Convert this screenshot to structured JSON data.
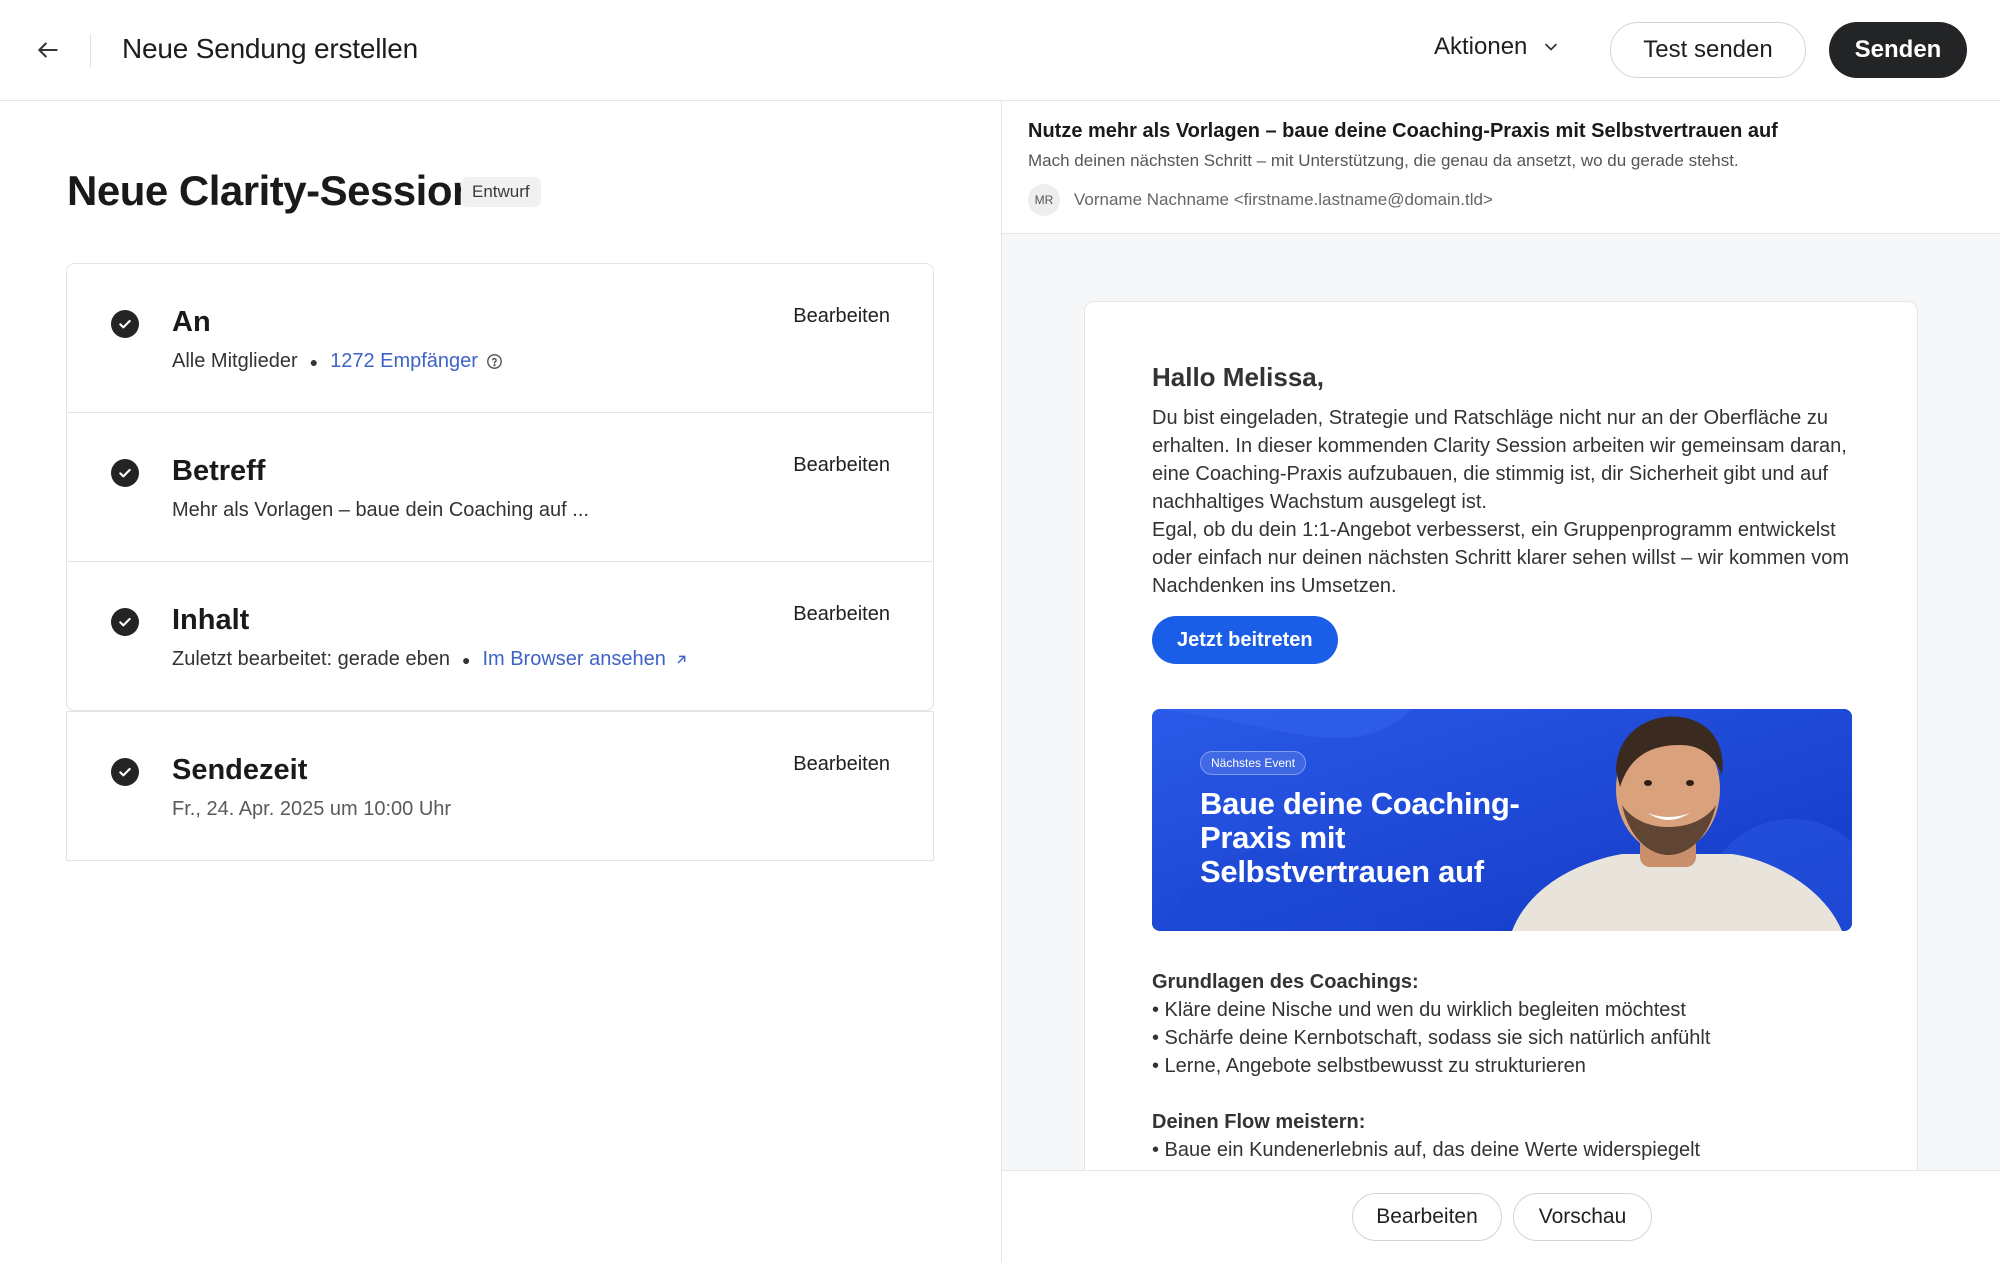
{
  "header": {
    "title": "Neue Sendung erstellen",
    "actions_label": "Aktionen",
    "test_send_label": "Test senden",
    "send_label": "Senden"
  },
  "campaign": {
    "title": "Neue Clarity-Session",
    "status": "Entwurf"
  },
  "steps": [
    {
      "title": "An",
      "edit_label": "Bearbeiten",
      "audience": "Alle Mitglieder",
      "recipients": "1272 Empfänger"
    },
    {
      "title": "Betreff",
      "edit_label": "Bearbeiten",
      "value": "Mehr als Vorlagen – baue dein Coaching auf ..."
    },
    {
      "title": "Inhalt",
      "edit_label": "Bearbeiten",
      "last_edited": "Zuletzt bearbeitet: gerade eben",
      "browser_link": "Im Browser ansehen"
    },
    {
      "title": "Sendezeit",
      "edit_label": "Bearbeiten",
      "value": "Fr., 24. Apr. 2025 um 10:00 Uhr"
    }
  ],
  "preview": {
    "subject": "Nutze mehr als Vorlagen – baue deine Coaching-Praxis mit Selbstvertrauen auf",
    "preheader": "Mach deinen nächsten Schritt – mit Unterstützung, die genau da ansetzt, wo du gerade stehst.",
    "sender_initials": "MR",
    "sender": "Vorname Nachname <firstname.lastname@domain.tld>",
    "greeting": "Hallo Melissa,",
    "paragraph_1": "Du bist eingeladen, Strategie und Ratschläge nicht nur an der Oberfläche zu erhalten. In dieser kommenden Clarity Session arbeiten wir gemeinsam daran, eine Coaching-Praxis aufzubauen, die stimmig ist, dir Sicherheit gibt und auf nachhaltiges Wachstum ausgelegt ist.",
    "paragraph_2": "Egal, ob du dein 1:1-Angebot verbesserst, ein Gruppenprogramm entwickelst oder einfach nur deinen nächsten Schritt klarer sehen willst – wir kommen vom Nachdenken ins Umsetzen.",
    "cta_label": "Jetzt beitreten",
    "banner_tag": "Nächstes Event",
    "banner_title": "Baue deine Coaching-Praxis mit Selbstvertrauen auf",
    "section_1_title": "Grundlagen des Coachings:",
    "section_1_items": [
      "• Kläre deine Nische und wen du wirklich begleiten möchtest",
      "• Schärfe deine Kernbotschaft, sodass sie sich natürlich anfühlt",
      "• Lerne, Angebote selbstbewusst zu strukturieren"
    ],
    "section_2_title": "Deinen Flow meistern:",
    "section_2_items": [
      "• Baue ein Kundenerlebnis auf, das deine Werte widerspiegelt"
    ],
    "edit_label": "Bearbeiten",
    "preview_label": "Vorschau"
  },
  "colors": {
    "primary_dark": "#222426",
    "link": "#3e63c7",
    "cta": "#1a5ee8",
    "banner": "#1b4bd6"
  }
}
